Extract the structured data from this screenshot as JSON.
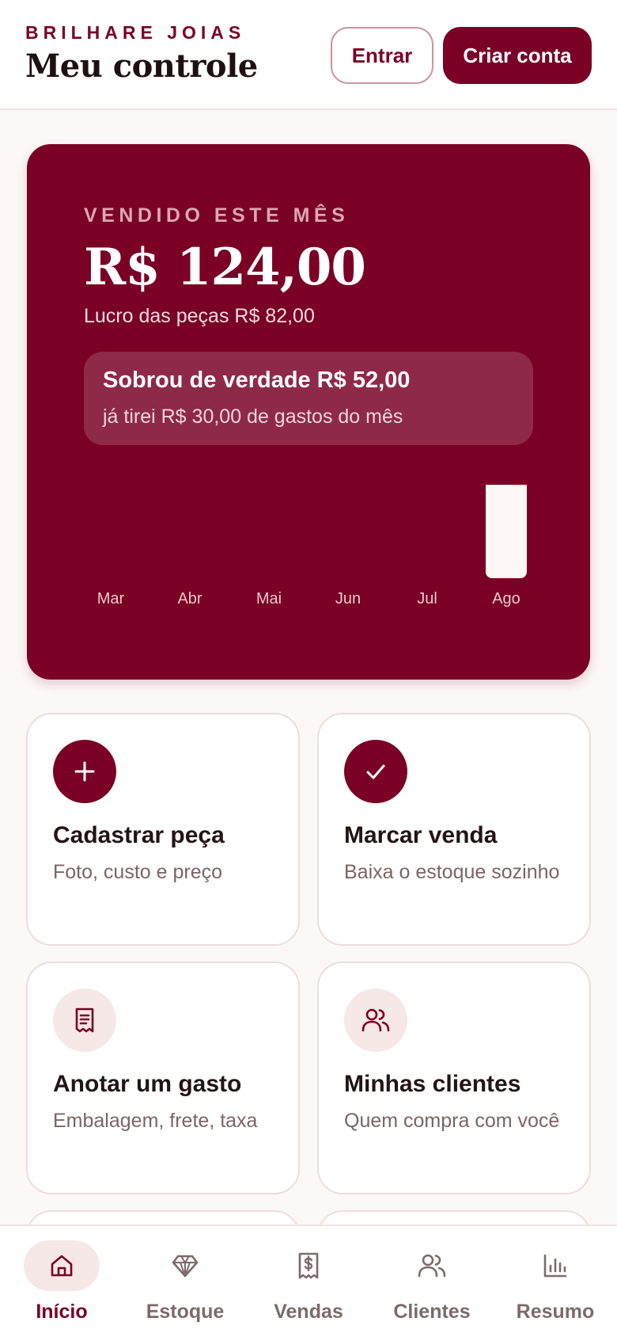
{
  "header": {
    "brand": "BRILHARE JOIAS",
    "title": "Meu controle",
    "login_label": "Entrar",
    "signup_label": "Criar conta"
  },
  "hero": {
    "label": "VENDIDO ESTE MÊS",
    "amount": "R$ 124,00",
    "profit": "Lucro das peças R$ 82,00",
    "box_title": "Sobrou de verdade R$ 52,00",
    "box_sub": "já tirei R$ 30,00 de gastos do mês"
  },
  "chart_data": {
    "type": "bar",
    "categories": [
      "Mar",
      "Abr",
      "Mai",
      "Jun",
      "Jul",
      "Ago"
    ],
    "values": [
      0,
      0,
      0,
      0,
      0,
      124
    ],
    "ylim": [
      0,
      124
    ],
    "grid": false,
    "bar_color": "#fdf7f5",
    "label_color": "#eac7d0"
  },
  "cards": [
    {
      "title": "Cadastrar peça",
      "desc": "Foto, custo e preço",
      "icon": "plus-icon"
    },
    {
      "title": "Marcar venda",
      "desc": "Baixa o estoque sozinho",
      "icon": "check-icon"
    },
    {
      "title": "Anotar um gasto",
      "desc": "Embalagem, frete, taxa",
      "icon": "receipt-icon"
    },
    {
      "title": "Minhas clientes",
      "desc": "Quem compra com você",
      "icon": "users-icon"
    }
  ],
  "nav": [
    {
      "label": "Início",
      "icon": "home-icon",
      "active": true
    },
    {
      "label": "Estoque",
      "icon": "diamond-icon",
      "active": false
    },
    {
      "label": "Vendas",
      "icon": "receipt-dollar-icon",
      "active": false
    },
    {
      "label": "Clientes",
      "icon": "users-icon",
      "active": false
    },
    {
      "label": "Resumo",
      "icon": "bar-chart-icon",
      "active": false
    }
  ],
  "colors": {
    "primary": "#7a0026",
    "background": "#fcf8f6",
    "soft": "#f5e8e7",
    "muted_text": "#7c6467"
  }
}
